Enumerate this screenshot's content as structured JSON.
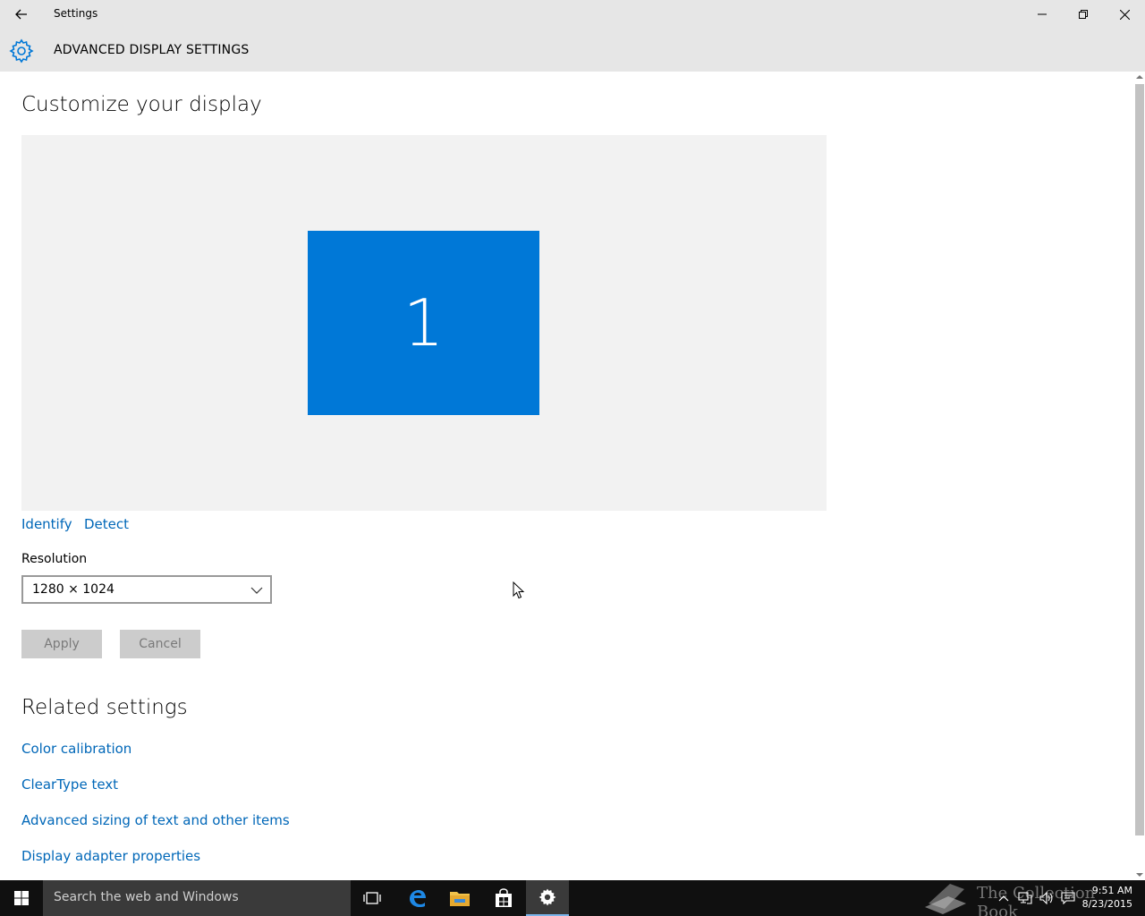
{
  "window": {
    "title": "Settings",
    "controls": {
      "minimize": "minimize-icon",
      "restore": "restore-icon",
      "close": "close-icon"
    }
  },
  "header": {
    "title": "ADVANCED DISPLAY SETTINGS",
    "icon": "gear-icon"
  },
  "main": {
    "heading": "Customize your display",
    "monitor_label": "1",
    "identify_link": "Identify",
    "detect_link": "Detect",
    "resolution_label": "Resolution",
    "resolution_value": "1280 × 1024",
    "apply_label": "Apply",
    "cancel_label": "Cancel"
  },
  "related": {
    "heading": "Related settings",
    "links": [
      "Color calibration",
      "ClearType text",
      "Advanced sizing of text and other items",
      "Display adapter properties"
    ]
  },
  "taskbar": {
    "search_placeholder": "Search the web and Windows",
    "watermark": "The Collection Book",
    "clock_time": "9:51 AM",
    "clock_date": "8/23/2015"
  },
  "colors": {
    "accent": "#0078d7",
    "link": "#0067b8",
    "chrome": "#e6e6e6",
    "taskbar": "#101010"
  }
}
